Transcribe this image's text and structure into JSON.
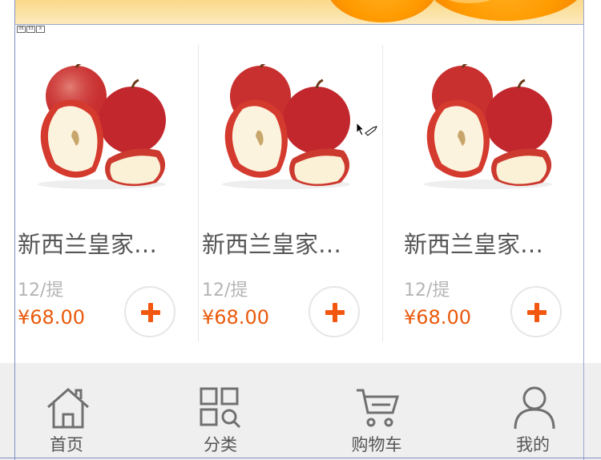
{
  "banner": {
    "image": "oranges-banner"
  },
  "design_guides": {
    "icons": [
      "05",
      "53",
      "X"
    ]
  },
  "products": [
    {
      "name": "新西兰皇家…",
      "unit": "12/提",
      "price": "¥68.00",
      "image": "red-apples-image"
    },
    {
      "name": "新西兰皇家…",
      "unit": "12/提",
      "price": "¥68.00",
      "image": "red-apples-image"
    },
    {
      "name": "新西兰皇家…",
      "unit": "12/提",
      "price": "¥68.00",
      "image": "red-apples-image"
    }
  ],
  "colors": {
    "accent": "#f2560f",
    "price": "#e95a0c",
    "name": "#555555",
    "unit": "#b5b5b5",
    "tabbar_bg": "#efefef"
  },
  "tabbar": {
    "items": [
      {
        "label": "首页",
        "icon": "home-icon"
      },
      {
        "label": "分类",
        "icon": "category-search-icon"
      },
      {
        "label": "购物车",
        "icon": "cart-icon"
      },
      {
        "label": "我的",
        "icon": "user-icon"
      }
    ]
  }
}
